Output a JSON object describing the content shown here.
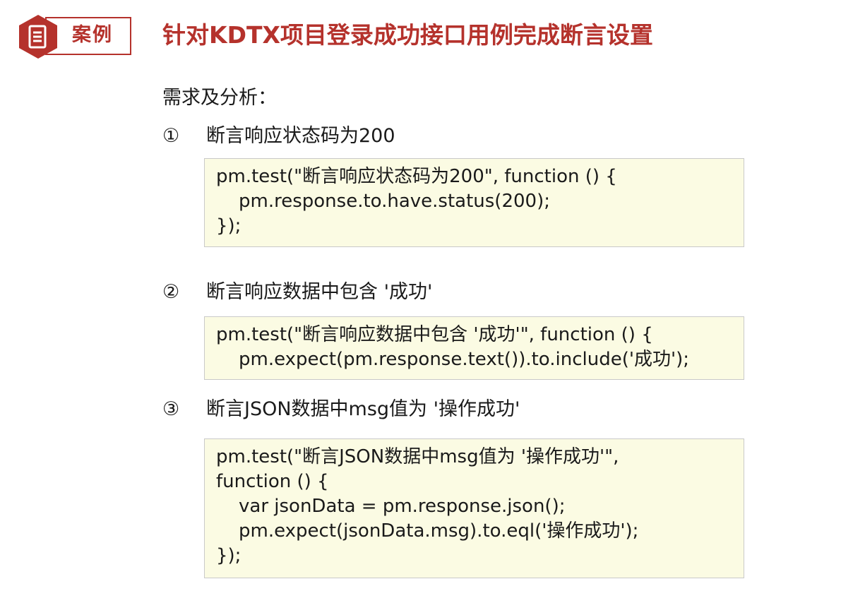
{
  "header": {
    "badge_label": "案例",
    "badge_icon": "document-icon",
    "title": "针对KDTX项目登录成功接口用例完成断言设置"
  },
  "colors": {
    "accent": "#b5322c",
    "code_background": "#fbfbe3",
    "code_border": "#c9c9c9"
  },
  "body": {
    "section_label": "需求及分析：",
    "steps": [
      {
        "number": "①",
        "text": "断言响应状态码为200",
        "code": [
          "pm.test(\"断言响应状态码为200\", function () {",
          "pm.response.to.have.status(200);",
          "});"
        ]
      },
      {
        "number": "②",
        "text": "断言响应数据中包含 '成功'",
        "code": [
          "pm.test(\"断言响应数据中包含 '成功'\", function () {",
          "pm.expect(pm.response.text()).to.include('成功');"
        ]
      },
      {
        "number": "③",
        "text": "断言JSON数据中msg值为 '操作成功'",
        "code": [
          "pm.test(\"断言JSON数据中msg值为 '操作成功'\",",
          "function () {",
          "var jsonData = pm.response.json();",
          "pm.expect(jsonData.msg).to.eql('操作成功');",
          "});"
        ]
      }
    ]
  }
}
